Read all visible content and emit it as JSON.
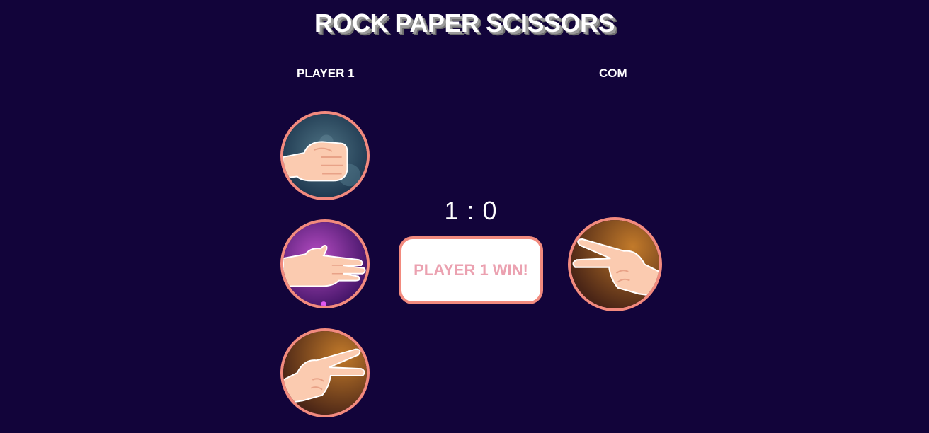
{
  "title": "ROCK PAPER SCISSORS",
  "player": {
    "label": "PLAYER 1"
  },
  "com": {
    "label": "COM"
  },
  "score": "1 : 0",
  "result": "PLAYER 1 WIN!",
  "choices": [
    "rock",
    "paper",
    "scissors"
  ],
  "com_choice": "scissors",
  "colors": {
    "background": "#12043a",
    "accent": "#f28a7e",
    "result_text": "#eba1b0"
  }
}
